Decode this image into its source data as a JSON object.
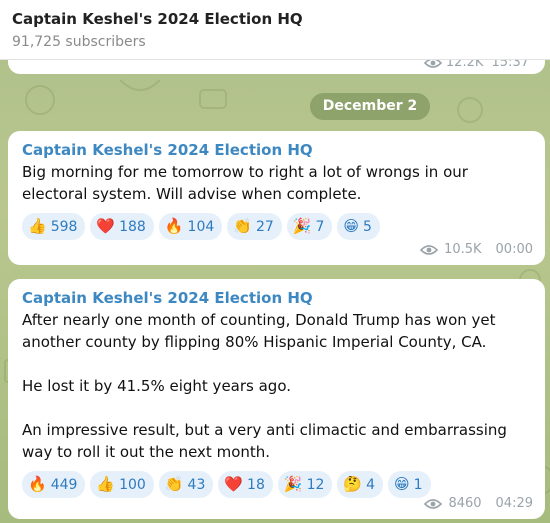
{
  "header": {
    "title": "Captain Keshel's 2024 Election HQ",
    "subscribers": "91,725 subscribers"
  },
  "prev_message": {
    "views": "12.2K",
    "time": "15:37"
  },
  "date_separator": "December 2",
  "messages": [
    {
      "author": "Captain Keshel's 2024 Election HQ",
      "text": "Big morning for me tomorrow to right a lot of wrongs in our electoral system. Will advise when complete.",
      "reactions": [
        {
          "emoji": "👍",
          "count": "598"
        },
        {
          "emoji": "❤️",
          "count": "188"
        },
        {
          "emoji": "🔥",
          "count": "104"
        },
        {
          "emoji": "👏",
          "count": "27"
        },
        {
          "emoji": "🎉",
          "count": "7"
        },
        {
          "emoji": "😁",
          "count": "5"
        }
      ],
      "views": "10.5K",
      "time": "00:00"
    },
    {
      "author": "Captain Keshel's 2024 Election HQ",
      "text": "After nearly one month of counting, Donald Trump has won yet another county by flipping 80% Hispanic Imperial County, CA.\n\nHe lost it by 41.5% eight years ago.\n\nAn impressive result, but a very anti climactic and embarrassing way to roll it out the next month.",
      "reactions": [
        {
          "emoji": "🔥",
          "count": "449"
        },
        {
          "emoji": "👍",
          "count": "100"
        },
        {
          "emoji": "👏",
          "count": "43"
        },
        {
          "emoji": "❤️",
          "count": "18"
        },
        {
          "emoji": "🎉",
          "count": "12"
        },
        {
          "emoji": "🤔",
          "count": "4"
        },
        {
          "emoji": "😁",
          "count": "1"
        }
      ],
      "views": "8460",
      "time": "04:29"
    }
  ]
}
